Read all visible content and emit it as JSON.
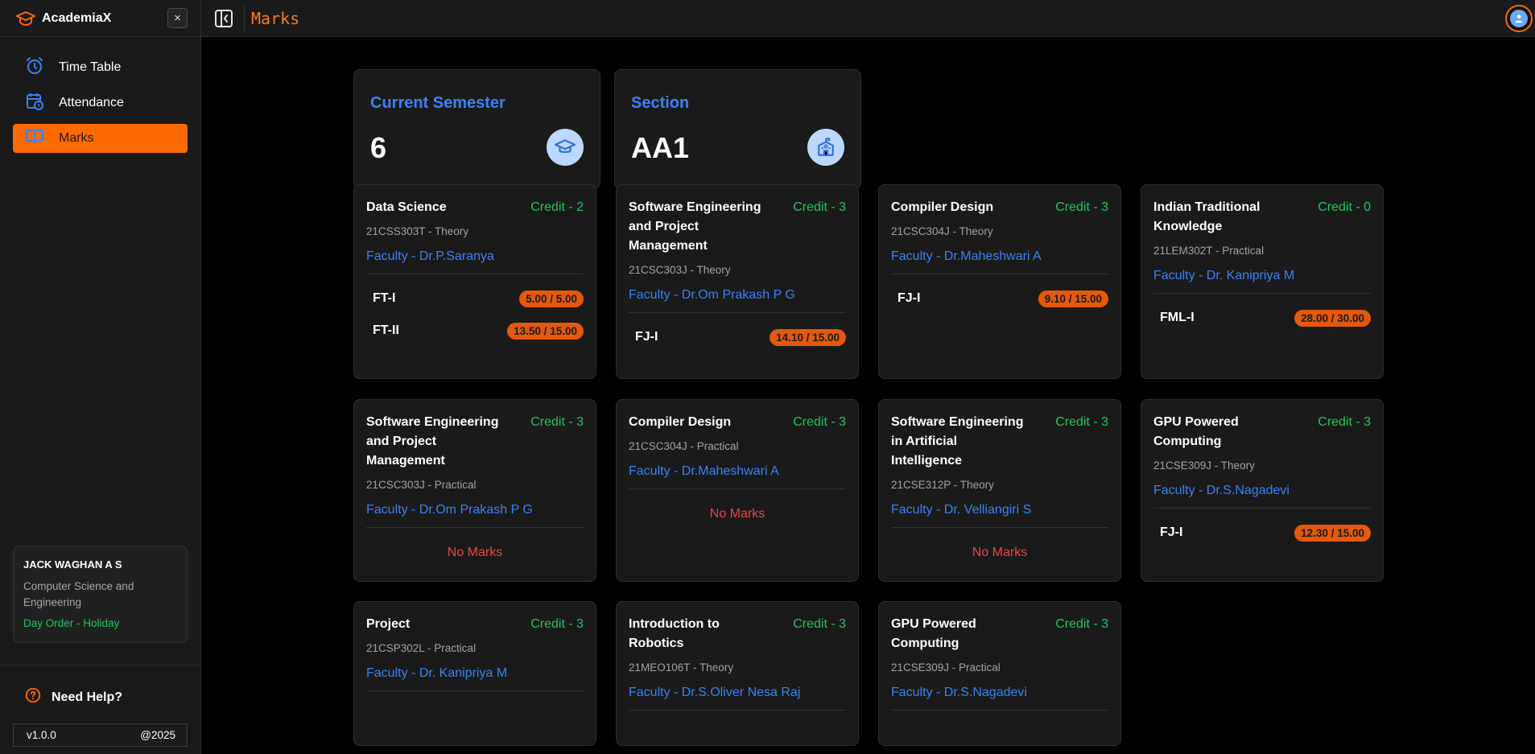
{
  "app": {
    "name": "AcademiaX",
    "close_label": "×"
  },
  "nav": [
    {
      "label": "Time Table",
      "icon": "alarm-clock-icon",
      "active": false
    },
    {
      "label": "Attendance",
      "icon": "calendar-clock-icon",
      "active": false
    },
    {
      "label": "Marks",
      "icon": "book-open-icon",
      "active": true
    }
  ],
  "user": {
    "name": "JACK WAGHAN A S",
    "department": "Computer Science and Engineering",
    "day_order": "Day Order  -  Holiday"
  },
  "help": {
    "label": "Need Help?"
  },
  "footer": {
    "version": "v1.0.0",
    "year": "@2025"
  },
  "topbar": {
    "title": "Marks"
  },
  "semester": {
    "label": "Current Semester",
    "value": "6"
  },
  "section": {
    "label": "Section",
    "value": "AA1"
  },
  "colors": {
    "accent": "#ff6a00",
    "blue": "#3b82f6",
    "green": "#22c55e",
    "red": "#ef4444",
    "badge": "#e4590b"
  },
  "no_marks_label": "No Marks",
  "courses": [
    {
      "name": "Data Science",
      "credit": "Credit  -  2",
      "code": "21CSS303T  -  Theory",
      "faculty": "Faculty  -  Dr.P.Saranya",
      "marks": [
        {
          "exam": "FT-I",
          "score": "5.00 / 5.00"
        },
        {
          "exam": "FT-II",
          "score": "13.50 / 15.00"
        }
      ]
    },
    {
      "name": "Software Engineering and Project Management",
      "credit": "Credit  -  3",
      "code": "21CSC303J  -  Theory",
      "faculty": "Faculty  -  Dr.Om Prakash P G",
      "marks": [
        {
          "exam": "FJ-I",
          "score": "14.10 / 15.00"
        }
      ]
    },
    {
      "name": "Compiler Design",
      "credit": "Credit  -  3",
      "code": "21CSC304J  -  Theory",
      "faculty": "Faculty  -  Dr.Maheshwari A",
      "marks": [
        {
          "exam": "FJ-I",
          "score": "9.10 / 15.00"
        }
      ]
    },
    {
      "name": "Indian Traditional Knowledge",
      "credit": "Credit  -  0",
      "code": "21LEM302T  -  Practical",
      "faculty": "Faculty  -  Dr. Kanipriya M",
      "marks": [
        {
          "exam": "FML-I",
          "score": "28.00 / 30.00"
        }
      ]
    },
    {
      "name": "Software Engineering and Project Management",
      "credit": "Credit  -  3",
      "code": "21CSC303J  -  Practical",
      "faculty": "Faculty  -  Dr.Om Prakash P G",
      "marks": []
    },
    {
      "name": "Compiler Design",
      "credit": "Credit  -  3",
      "code": "21CSC304J  -  Practical",
      "faculty": "Faculty  -  Dr.Maheshwari A",
      "marks": []
    },
    {
      "name": "Software Engineering in Artificial Intelligence",
      "credit": "Credit  -  3",
      "code": "21CSE312P  -  Theory",
      "faculty": "Faculty  -  Dr. Velliangiri S",
      "marks": []
    },
    {
      "name": "GPU Powered Computing",
      "credit": "Credit  -  3",
      "code": "21CSE309J  -  Theory",
      "faculty": "Faculty  -  Dr.S.Nagadevi",
      "marks": [
        {
          "exam": "FJ-I",
          "score": "12.30 / 15.00"
        }
      ]
    },
    {
      "name": "Project",
      "credit": "Credit  -  3",
      "code": "21CSP302L  -  Practical",
      "faculty": "Faculty  -  Dr. Kanipriya M",
      "marks": []
    },
    {
      "name": "Introduction to Robotics",
      "credit": "Credit  -  3",
      "code": "21MEO106T  -  Theory",
      "faculty": "Faculty  -  Dr.S.Oliver Nesa Raj",
      "marks": []
    },
    {
      "name": "GPU Powered Computing",
      "credit": "Credit  -  3",
      "code": "21CSE309J  -  Practical",
      "faculty": "Faculty  -  Dr.S.Nagadevi",
      "marks": []
    }
  ]
}
